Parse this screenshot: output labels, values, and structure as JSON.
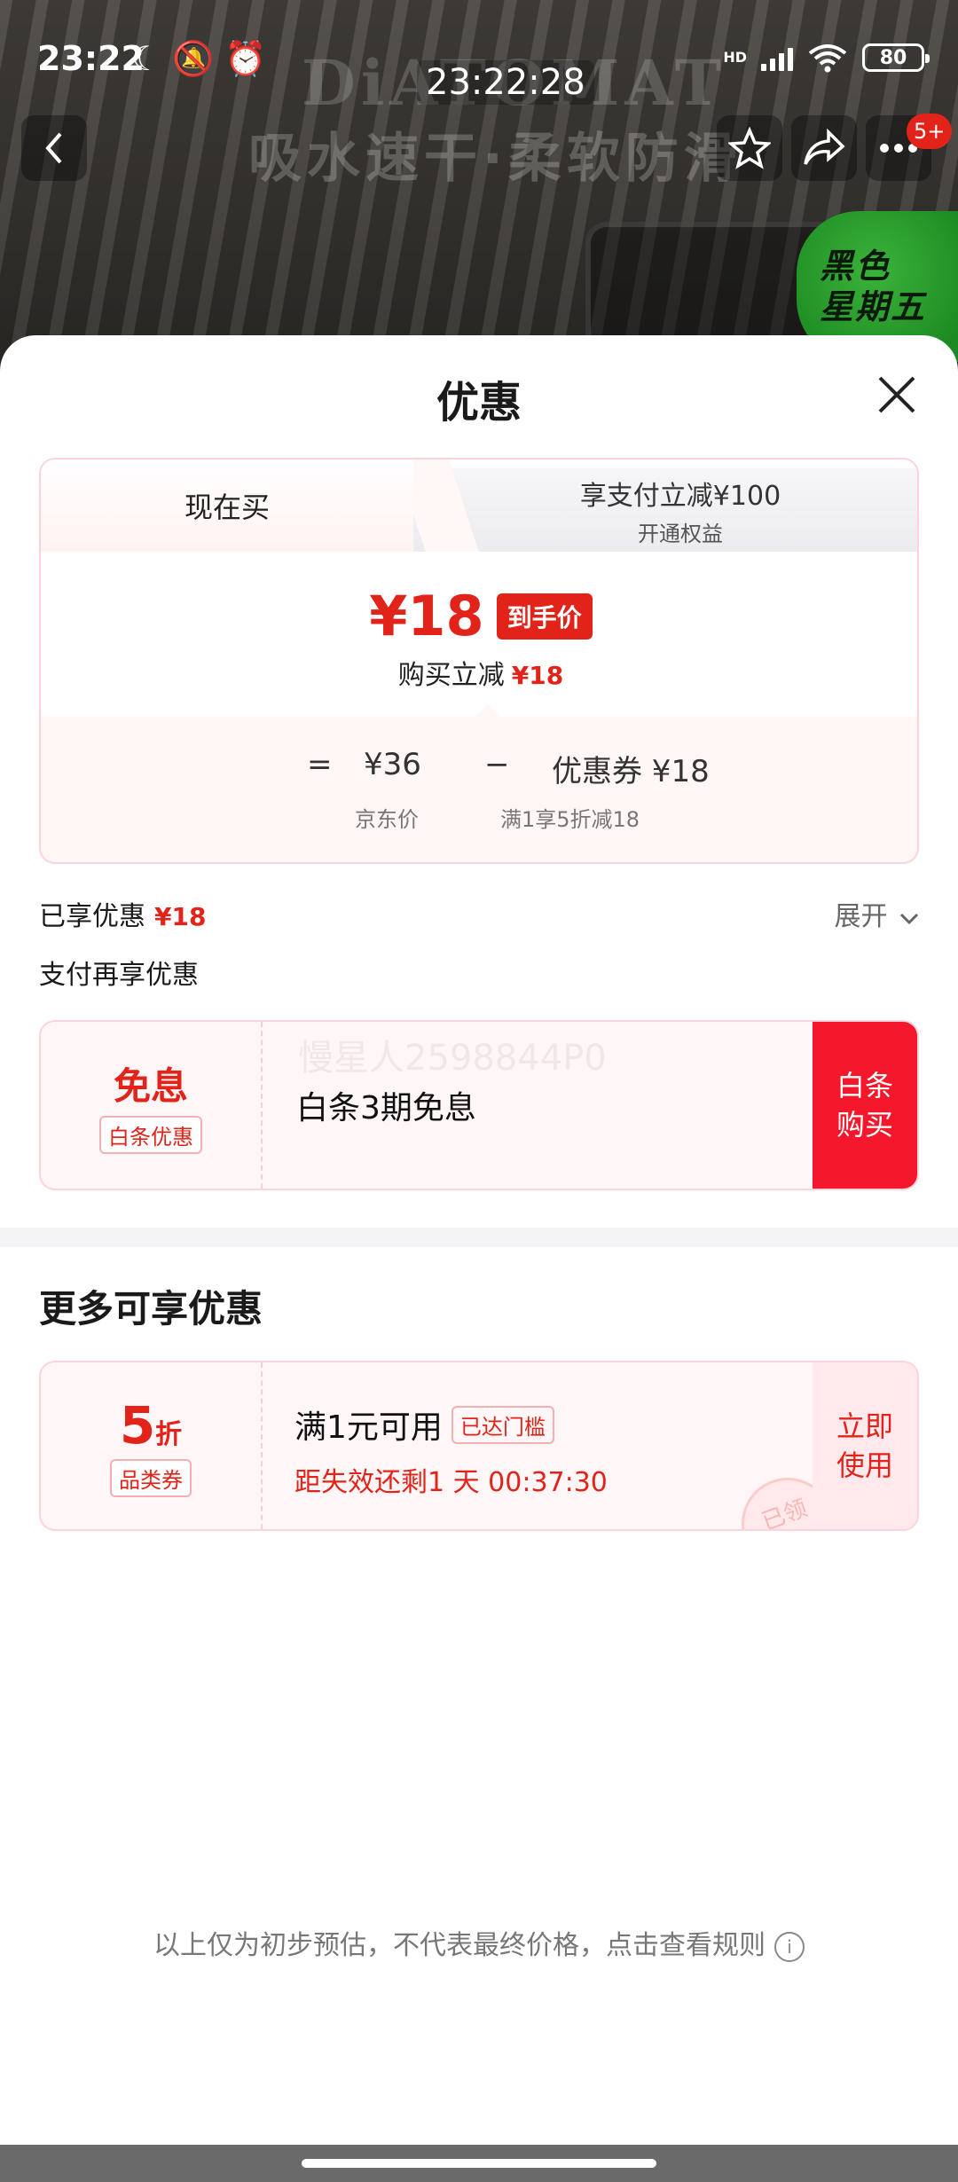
{
  "status_bar": {
    "time": "23:22",
    "clock_overlay": "23:22:28",
    "network": "HD",
    "battery": "80"
  },
  "background": {
    "brand": "DiATOMAT",
    "slogan": "吸水速干·柔软防滑",
    "badge_count": "5+",
    "promo_line1": "黑色",
    "promo_line2": "星期五",
    "icons": [
      "back-icon",
      "star-icon",
      "share-icon",
      "more-icon"
    ]
  },
  "sheet": {
    "title": "优惠",
    "tabs": {
      "now": "现在买",
      "pay_title": "享支付立减¥100",
      "pay_sub": "开通权益"
    },
    "price": {
      "amount": "¥18",
      "tag": "到手价",
      "sub_label": "购买立减",
      "sub_amount": "¥18"
    },
    "breakdown": {
      "eq": "=",
      "jd_price": "¥36",
      "minus": "−",
      "coupon": "优惠券 ¥18",
      "jd_price_label": "京东价",
      "coupon_label": "满1享5折减18"
    },
    "saved": {
      "label": "已享优惠",
      "amount": "¥18",
      "expand": "展开"
    },
    "pay_more": "支付再享优惠",
    "baitiao": {
      "big": "免息",
      "tag": "白条优惠",
      "watermark": "慢星人2598844P0",
      "text": "白条3期免息",
      "buy_line1": "白条",
      "buy_line2": "购买"
    },
    "more_title": "更多可享优惠",
    "coupon": {
      "num": "5",
      "unit": "折",
      "tag": "品类券",
      "line1": "满1元可用",
      "badge": "已达门槛",
      "line2": "距失效还剩1 天 00:37:30",
      "stamp": "已领",
      "use_line1": "立即",
      "use_line2": "使用"
    },
    "notice": "以上仅为初步预估，不代表最终价格，点击查看规则"
  },
  "colors": {
    "accent": "#e2231a",
    "card_border": "#f9d4dc",
    "card_bg": "#fff6f7"
  }
}
